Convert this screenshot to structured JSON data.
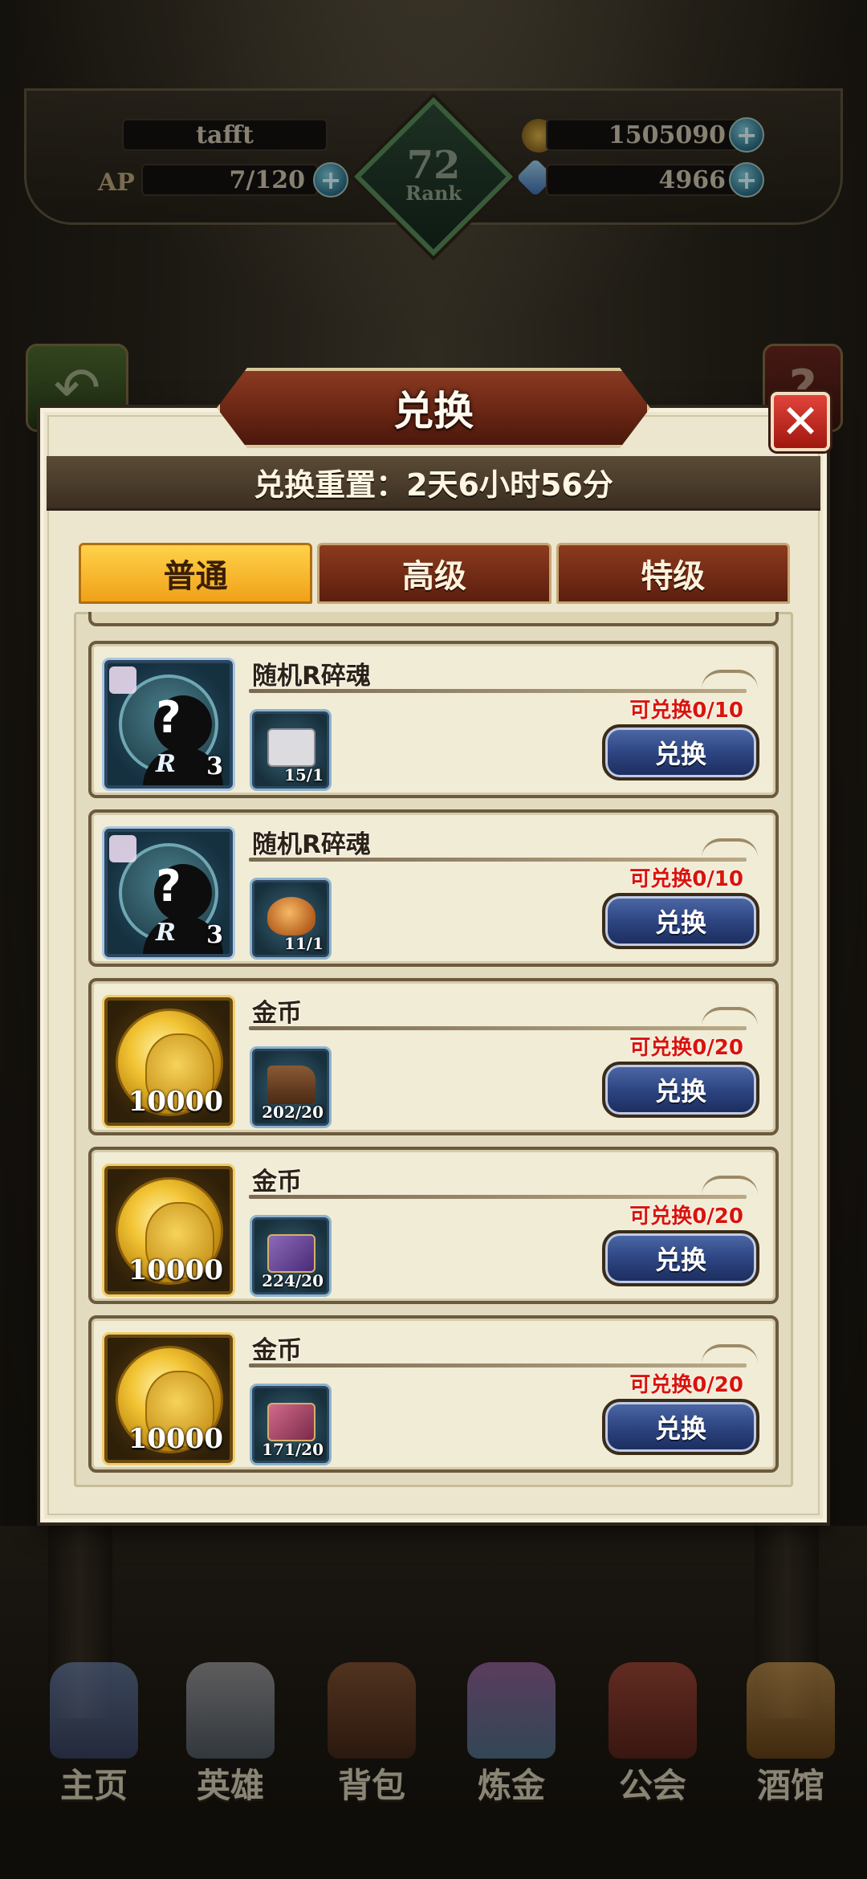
{
  "hud": {
    "player_name": "tafft",
    "ap_label": "AP",
    "ap_value": "7/120",
    "rank_value": "72",
    "rank_label": "Rank",
    "gold_value": "1505090",
    "gem_value": "4966",
    "plus_symbol": "+"
  },
  "dialog": {
    "title": "兑换",
    "close_symbol": "✕",
    "reset_text": "兑换重置：2天6小时56分"
  },
  "tabs": [
    {
      "label": "普通",
      "active": true
    },
    {
      "label": "高级",
      "active": false
    },
    {
      "label": "特级",
      "active": false
    }
  ],
  "rows": [
    {
      "name": "随机R碎魂",
      "reward_type": "random-r-soul-icon",
      "reward_count": "3",
      "cost_item": "ticket-icon",
      "cost_count": "15/1",
      "limit": "可兑换0/10",
      "button": "兑换"
    },
    {
      "name": "随机R碎魂",
      "reward_type": "random-r-soul-icon",
      "reward_count": "3",
      "cost_item": "bread-icon",
      "cost_count": "11/1",
      "limit": "可兑换0/10",
      "button": "兑换"
    },
    {
      "name": "金币",
      "reward_type": "gold-coin-icon",
      "reward_count": "10000",
      "cost_item": "boots-icon",
      "cost_count": "202/20",
      "limit": "可兑换0/20",
      "button": "兑换"
    },
    {
      "name": "金币",
      "reward_type": "gold-coin-icon",
      "reward_count": "10000",
      "cost_item": "purple-book-icon",
      "cost_count": "224/20",
      "limit": "可兑换0/20",
      "button": "兑换"
    },
    {
      "name": "金币",
      "reward_type": "gold-coin-icon",
      "reward_count": "10000",
      "cost_item": "pink-book-icon",
      "cost_count": "171/20",
      "limit": "可兑换0/20",
      "button": "兑换"
    }
  ],
  "r_letter": "R",
  "question_mark": "?",
  "nav": [
    {
      "label": "主页",
      "icon": "castle-icon"
    },
    {
      "label": "英雄",
      "icon": "hero-helmet-icon"
    },
    {
      "label": "背包",
      "icon": "backpack-icon"
    },
    {
      "label": "炼金",
      "icon": "alchemy-flask-icon"
    },
    {
      "label": "公会",
      "icon": "guild-shield-icon"
    },
    {
      "label": "酒馆",
      "icon": "tavern-mug-icon"
    }
  ],
  "colors": {
    "panel_bg": "#ece6cf",
    "tab_active": "#f0a118",
    "tab_inactive": "#6a2614",
    "limit_text": "#d8140c",
    "exchange_button": "#2d4582"
  }
}
